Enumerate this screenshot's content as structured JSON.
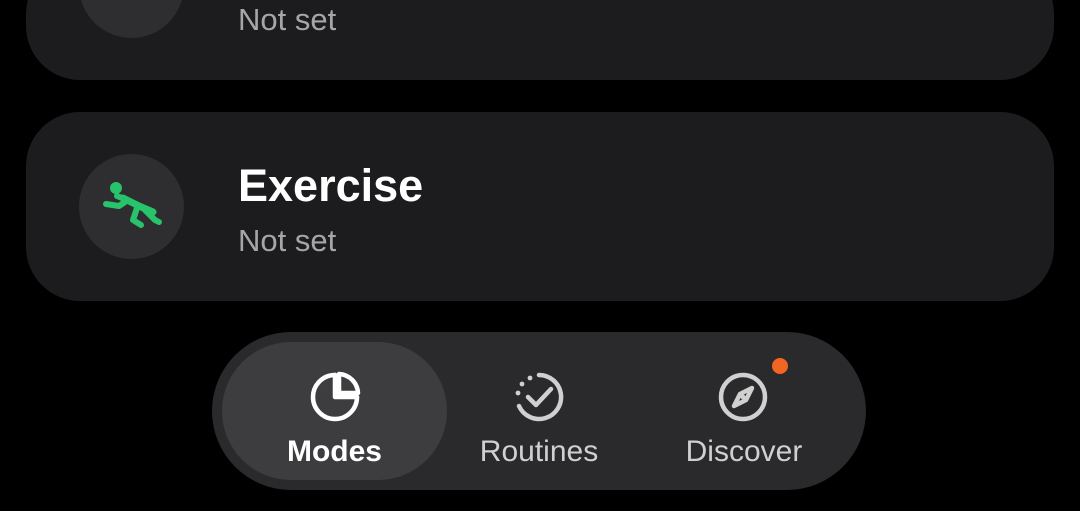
{
  "modes": [
    {
      "title": "",
      "subtitle": "Not set",
      "icon": "sleep-bed-icon",
      "icon_color": "#4aa8f0"
    },
    {
      "title": "Exercise",
      "subtitle": "Not set",
      "icon": "exercise-runner-icon",
      "icon_color": "#27c46b"
    }
  ],
  "nav": {
    "items": [
      {
        "label": "Modes",
        "icon": "modes-pie-icon",
        "active": true
      },
      {
        "label": "Routines",
        "icon": "routines-check-icon",
        "active": false
      },
      {
        "label": "Discover",
        "icon": "discover-compass-icon",
        "active": false,
        "badge": true
      }
    ],
    "badge_color": "#f26522"
  },
  "colors": {
    "background": "#000000",
    "card": "#1c1c1e",
    "icon_circle": "#2e2e30",
    "nav_bar": "#2a2a2c",
    "nav_active": "#3d3d3f",
    "subtitle_text": "#a6a6a6"
  }
}
